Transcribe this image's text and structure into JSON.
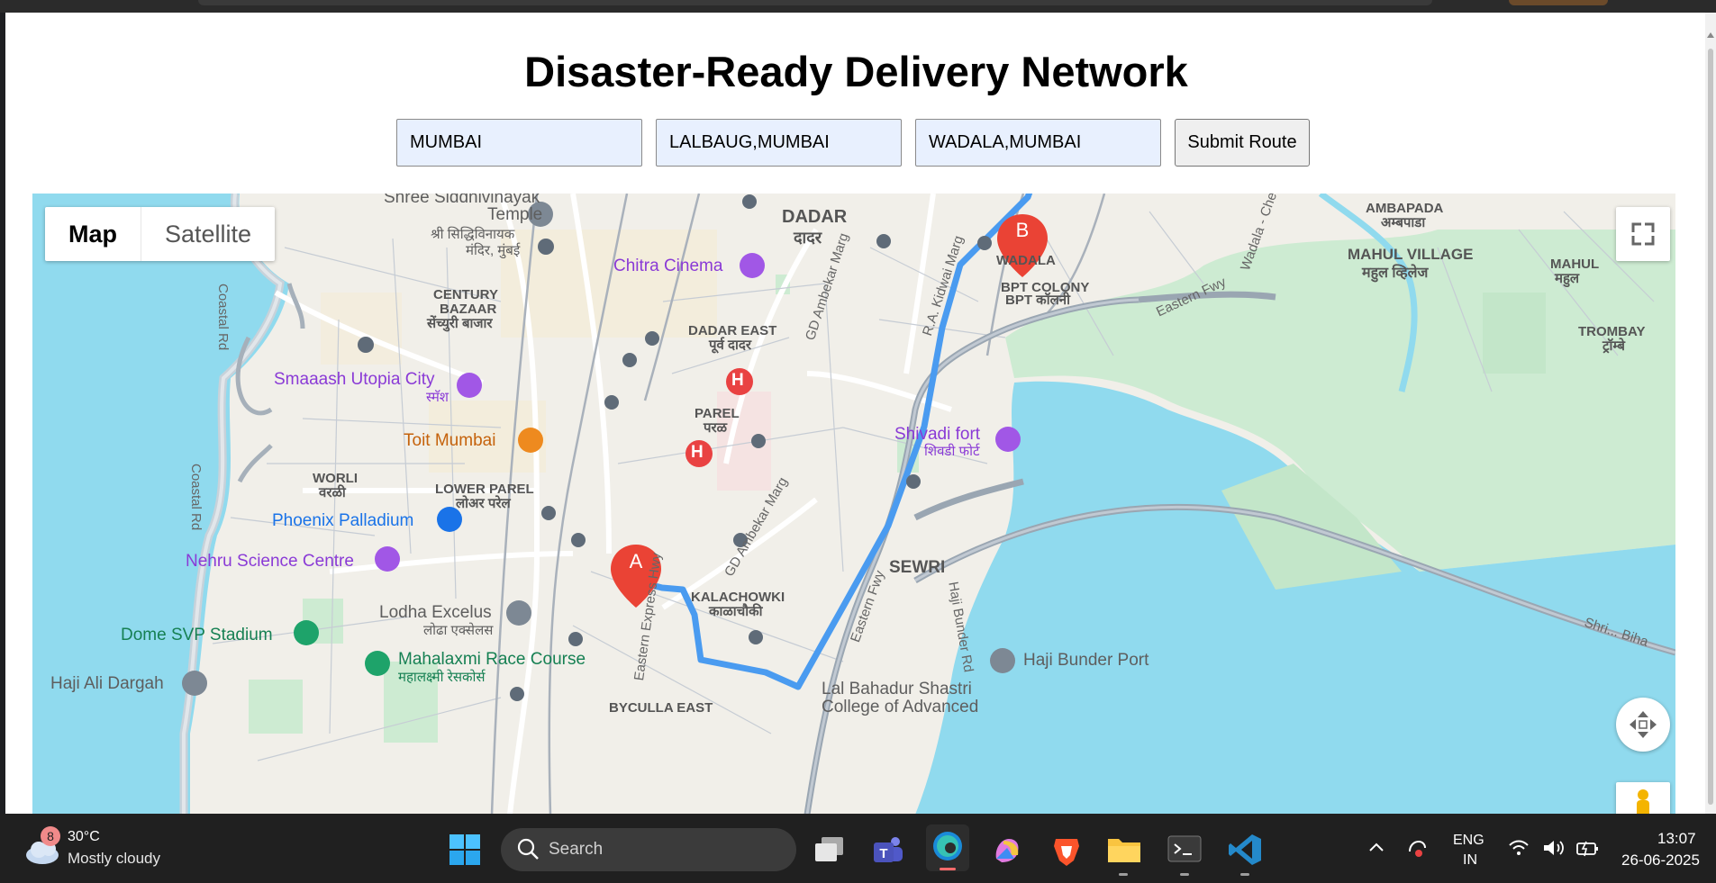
{
  "page": {
    "title": "Disaster-Ready Delivery Network",
    "inputs": [
      {
        "value": "MUMBAI"
      },
      {
        "value": "LALBAUG,MUMBAI"
      },
      {
        "value": "WADALA,MUMBAI"
      }
    ],
    "submit_label": "Submit Route"
  },
  "map": {
    "type_control": {
      "map_label": "Map",
      "satellite_label": "Satellite",
      "selected": "Map"
    },
    "markers": {
      "start": "A",
      "end": "B"
    },
    "route_color": "#4a9bf0",
    "labels": {
      "dadar": "DADAR",
      "dadar_dev": "दादर",
      "siddhivinayak": "Shree Siddhivinayak",
      "temple": "Temple",
      "siddhivinayak_dev1": "श्री सिद्धिविनायक",
      "siddhivinayak_dev2": "मंदिर, मुंबई",
      "chitra": "Chitra Cinema",
      "century1": "CENTURY",
      "century2": "BAZAAR",
      "century_dev": "सेंच्युरी बाजार",
      "dadar_east": "DADAR EAST",
      "dadar_east_dev": "पूर्व दादर",
      "smaaash": "Smaaash Utopia City",
      "smaaash_dev": "स्मॅश",
      "parel": "PAREL",
      "parel_dev": "परळ",
      "toit": "Toit Mumbai",
      "worli": "WORLI",
      "worli_dev": "वरळी",
      "lower_parel": "LOWER PAREL",
      "lower_parel_dev": "लोअर परेल",
      "phoenix": "Phoenix Palladium",
      "nehru": "Nehru Science Centre",
      "lodha": "Lodha Excelus",
      "lodha_dev": "लोढा एक्सेलस",
      "dome": "Dome SVP Stadium",
      "mahalaxmi": "Mahalaxmi Race Course",
      "mahalaxmi_dev": "महालक्ष्मी रेसकोर्स",
      "haji_ali": "Haji Ali Dargah",
      "kalachowki": "KALACHOWKI",
      "kalachowki_dev": "काळाचौकी",
      "sewri": "SEWRI",
      "shivadi": "Shivadi fort",
      "shivadi_dev": "शिवडी फोर्ट",
      "haji_bunder": "Haji Bunder Port",
      "lbs1": "Lal Bahadur Shastri",
      "lbs2": "College of Advanced",
      "byculla": "BYCULLA EAST",
      "wadala": "WADALA",
      "bpt1": "BPT COLONY",
      "bpt_dev": "BPT कॉलनी",
      "mahul_village": "MAHUL VILLAGE",
      "mahul_village_dev": "महुल व्हिलेज",
      "ambapada": "AMBAPADA",
      "ambapada_dev": "अम्बपाडा",
      "mahul": "MAHUL",
      "mahul_dev": "महुल",
      "trombay": "TROMBAY",
      "trombay_dev": "ट्रॉम्बे",
      "coastal1": "Coastal Rd",
      "coastal2": "Coastal Rd",
      "gd_ambekar1": "GD Ambekar Marg",
      "gd_ambekar2": "GD Ambekar Marg",
      "rak": "R.A. Kidwai Marg",
      "eastern_fwy1": "Eastern Fwy",
      "eastern_fwy2": "Eastern Fwy",
      "eastern_exp": "Eastern Express Hwy",
      "haji_bunder_rd": "Haji Bunder Rd",
      "wadala_chem": "Wadala - Chem",
      "shrivardhan": "Shri... Biha"
    }
  },
  "taskbar": {
    "weather": {
      "badge": "8",
      "temp": "30°C",
      "desc": "Mostly cloudy"
    },
    "search_placeholder": "Search",
    "lang1": "ENG",
    "lang2": "IN",
    "time": "13:07",
    "date": "26-06-2025"
  }
}
